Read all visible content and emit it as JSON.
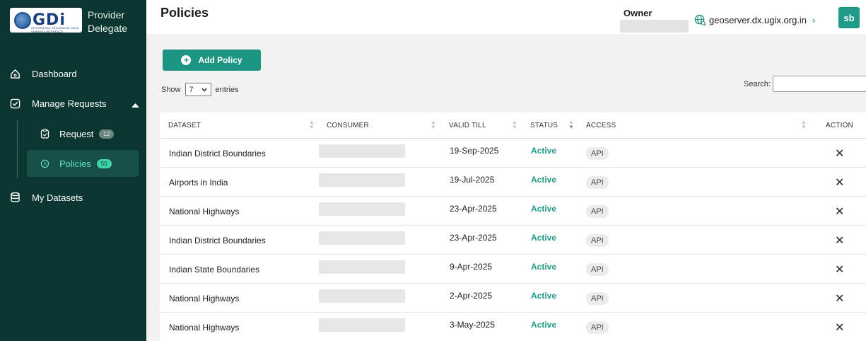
{
  "brand": {
    "logo_text": "GDi",
    "logo_subtext": "INTEGRATED GEOSPATIAL DATA SHARING INTERFACE"
  },
  "role": {
    "line1": "Provider",
    "line2": "Delegate"
  },
  "sidebar": {
    "dashboard": "Dashboard",
    "manage_requests": "Manage Requests",
    "request": {
      "label": "Request",
      "count": "12"
    },
    "policies": {
      "label": "Policies",
      "count": "55"
    },
    "my_datasets": "My Datasets"
  },
  "header": {
    "title": "Policies",
    "owner_label": "Owner",
    "server": "geoserver.dx.ugix.org.in",
    "server_chevron": "›",
    "avatar": "sb"
  },
  "toolbar": {
    "add_label": "Add Policy",
    "show_label": "Show",
    "entries_value": "7",
    "entries_label": "entries",
    "search_label": "Search:"
  },
  "table": {
    "columns": [
      "DATASET",
      "CONSUMER",
      "VALID TILL",
      "STATUS",
      "ACCESS",
      "ACTION"
    ],
    "rows": [
      {
        "dataset": "Indian District Boundaries",
        "valid_till": "19-Sep-2025",
        "status": "Active",
        "access": "API",
        "action": "✕"
      },
      {
        "dataset": "Airports in India",
        "valid_till": "19-Jul-2025",
        "status": "Active",
        "access": "API",
        "action": "✕"
      },
      {
        "dataset": "National Highways",
        "valid_till": "23-Apr-2025",
        "status": "Active",
        "access": "API",
        "action": "✕"
      },
      {
        "dataset": "Indian District Boundaries",
        "valid_till": "23-Apr-2025",
        "status": "Active",
        "access": "API",
        "action": "✕"
      },
      {
        "dataset": "Indian State Boundaries",
        "valid_till": "9-Apr-2025",
        "status": "Active",
        "access": "API",
        "action": "✕"
      },
      {
        "dataset": "National Highways",
        "valid_till": "2-Apr-2025",
        "status": "Active",
        "access": "API",
        "action": "✕"
      },
      {
        "dataset": "National Highways",
        "valid_till": "3-May-2025",
        "status": "Active",
        "access": "API",
        "action": "✕"
      }
    ]
  },
  "icons": {
    "dashboard": "home-icon",
    "manage_requests": "check-square-icon",
    "request": "clipboard-icon",
    "policies": "clock-icon",
    "my_datasets": "database-icon",
    "server": "globe-icon",
    "add": "plus-circle-icon",
    "action": "close-icon"
  },
  "colors": {
    "sidebar": "#0b3530",
    "accent": "#1c9582",
    "status": "#1f9a86"
  }
}
